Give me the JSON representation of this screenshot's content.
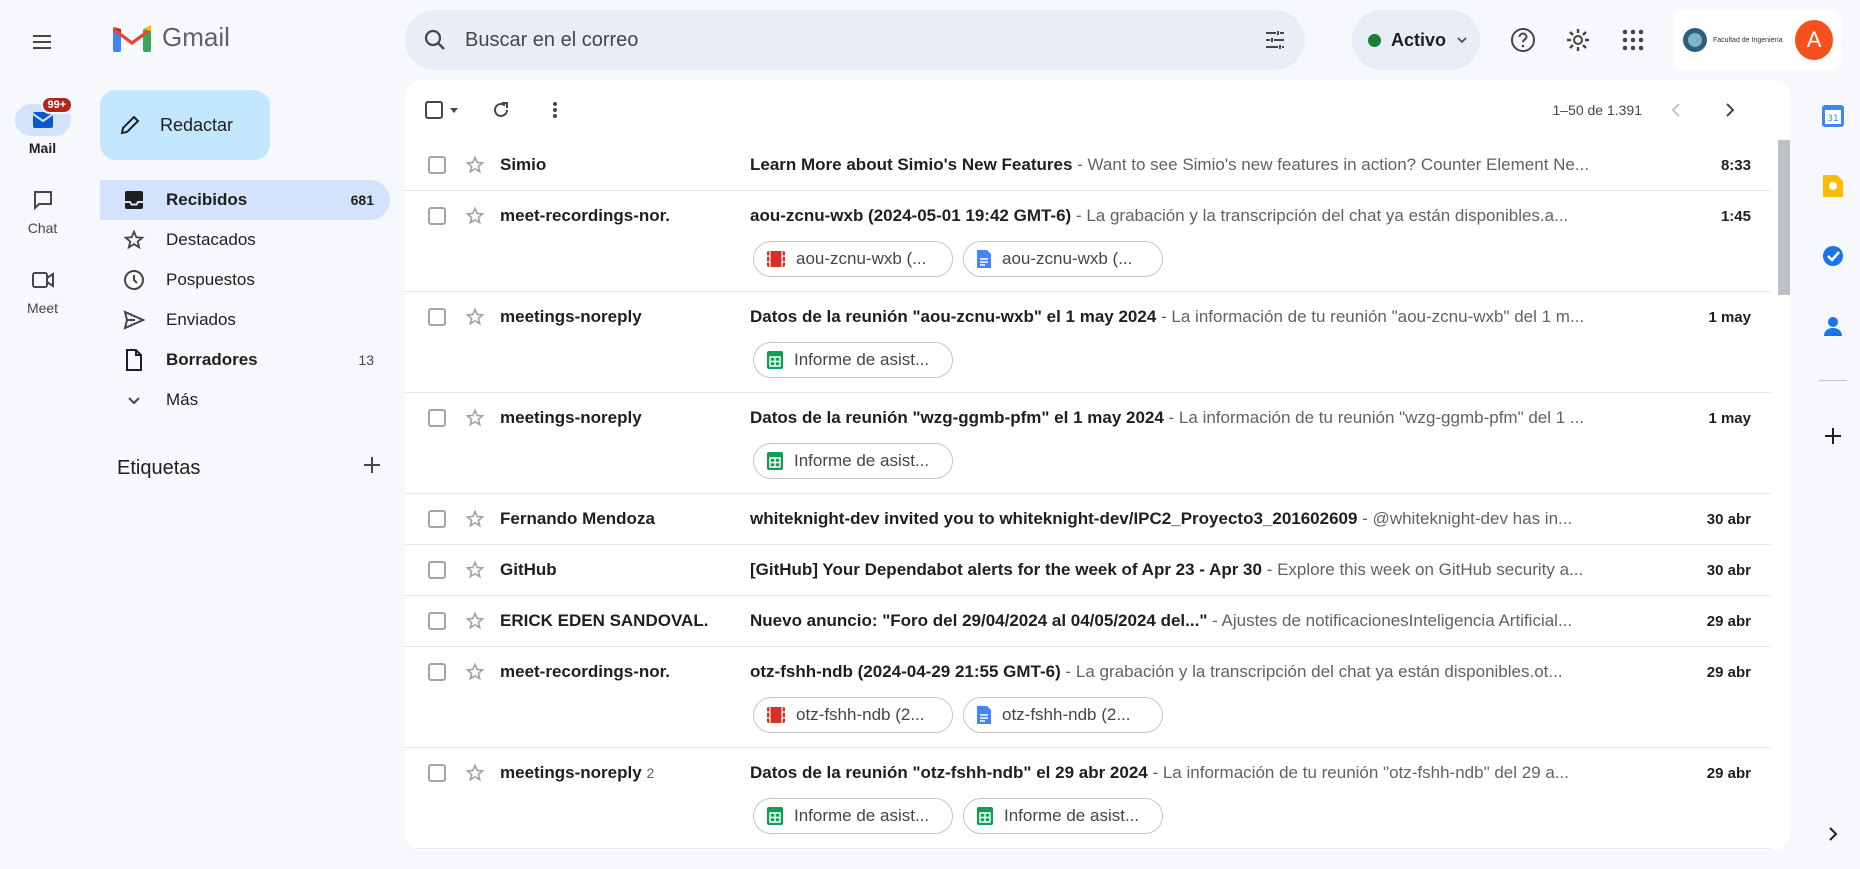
{
  "app": {
    "logo_text": "Gmail"
  },
  "rail": {
    "items": [
      {
        "label": "Mail",
        "badge": "99+",
        "icon": "mail-icon"
      },
      {
        "label": "Chat",
        "icon": "chat-icon"
      },
      {
        "label": "Meet",
        "icon": "video-icon"
      }
    ]
  },
  "search": {
    "placeholder": "Buscar en el correo"
  },
  "status": {
    "label": "Activo",
    "color": "#188038"
  },
  "account": {
    "avatar_letter": "A",
    "org_name": "Facultad de Ingeniería"
  },
  "compose": {
    "label": "Redactar"
  },
  "nav": {
    "items": [
      {
        "label": "Recibidos",
        "count": "681"
      },
      {
        "label": "Destacados",
        "count": ""
      },
      {
        "label": "Pospuestos",
        "count": ""
      },
      {
        "label": "Enviados",
        "count": ""
      },
      {
        "label": "Borradores",
        "count": "13"
      },
      {
        "label": "Más",
        "count": ""
      }
    ],
    "labels_heading": "Etiquetas"
  },
  "pager": {
    "range": "1–50 de 1.391"
  },
  "emails": [
    {
      "sender": "Simio",
      "count": "",
      "subject": "Learn More about Simio's New Features",
      "snippet": " - Want to see Simio's new features in action? Counter Element Ne...",
      "date": "8:33",
      "attachments": []
    },
    {
      "sender": "meet-recordings-nor.",
      "count": "",
      "subject": "aou-zcnu-wxb (2024-05-01 19:42 GMT-6)",
      "snippet": " - La grabación y la transcripción del chat ya están disponibles.a...",
      "date": "1:45",
      "attachments": [
        {
          "name": "aou-zcnu-wxb (...",
          "icon": "video-file-icon"
        },
        {
          "name": "aou-zcnu-wxb (...",
          "icon": "doc-file-icon"
        }
      ]
    },
    {
      "sender": "meetings-noreply",
      "count": "",
      "subject": "Datos de la reunión \"aou-zcnu-wxb\" el 1 may 2024",
      "snippet": " - La información de tu reunión \"aou-zcnu-wxb\" del 1 m...",
      "date": "1 may",
      "attachments": [
        {
          "name": "Informe de asist...",
          "icon": "sheet-file-icon"
        }
      ]
    },
    {
      "sender": "meetings-noreply",
      "count": "",
      "subject": "Datos de la reunión \"wzg-ggmb-pfm\" el 1 may 2024",
      "snippet": " - La información de tu reunión \"wzg-ggmb-pfm\" del 1 ...",
      "date": "1 may",
      "attachments": [
        {
          "name": "Informe de asist...",
          "icon": "sheet-file-icon"
        }
      ]
    },
    {
      "sender": "Fernando Mendoza",
      "count": "",
      "subject": "whiteknight-dev invited you to whiteknight-dev/IPC2_Proyecto3_201602609",
      "snippet": " - @whiteknight-dev has in...",
      "date": "30 abr",
      "attachments": []
    },
    {
      "sender": "GitHub",
      "count": "",
      "subject": "[GitHub] Your Dependabot alerts for the week of Apr 23 - Apr 30",
      "snippet": " - Explore this week on GitHub security a...",
      "date": "30 abr",
      "attachments": []
    },
    {
      "sender": "ERICK EDEN SANDOVAL.",
      "count": "",
      "subject": "Nuevo anuncio: \"Foro del 29/04/2024 al 04/05/2024 del...\"",
      "snippet": " - Ajustes de notificacionesInteligencia Artificial...",
      "date": "29 abr",
      "attachments": []
    },
    {
      "sender": "meet-recordings-nor.",
      "count": "",
      "subject": "otz-fshh-ndb (2024-04-29 21:55 GMT-6)",
      "snippet": " - La grabación y la transcripción del chat ya están disponibles.ot...",
      "date": "29 abr",
      "attachments": [
        {
          "name": "otz-fshh-ndb (2...",
          "icon": "video-file-icon"
        },
        {
          "name": "otz-fshh-ndb (2...",
          "icon": "doc-file-icon"
        }
      ]
    },
    {
      "sender": "meetings-noreply",
      "count": "2",
      "subject": "Datos de la reunión \"otz-fshh-ndb\" el 29 abr 2024",
      "snippet": " - La información de tu reunión \"otz-fshh-ndb\" del 29 a...",
      "date": "29 abr",
      "attachments": [
        {
          "name": "Informe de asist...",
          "icon": "sheet-file-icon"
        },
        {
          "name": "Informe de asist...",
          "icon": "sheet-file-icon"
        }
      ]
    }
  ]
}
